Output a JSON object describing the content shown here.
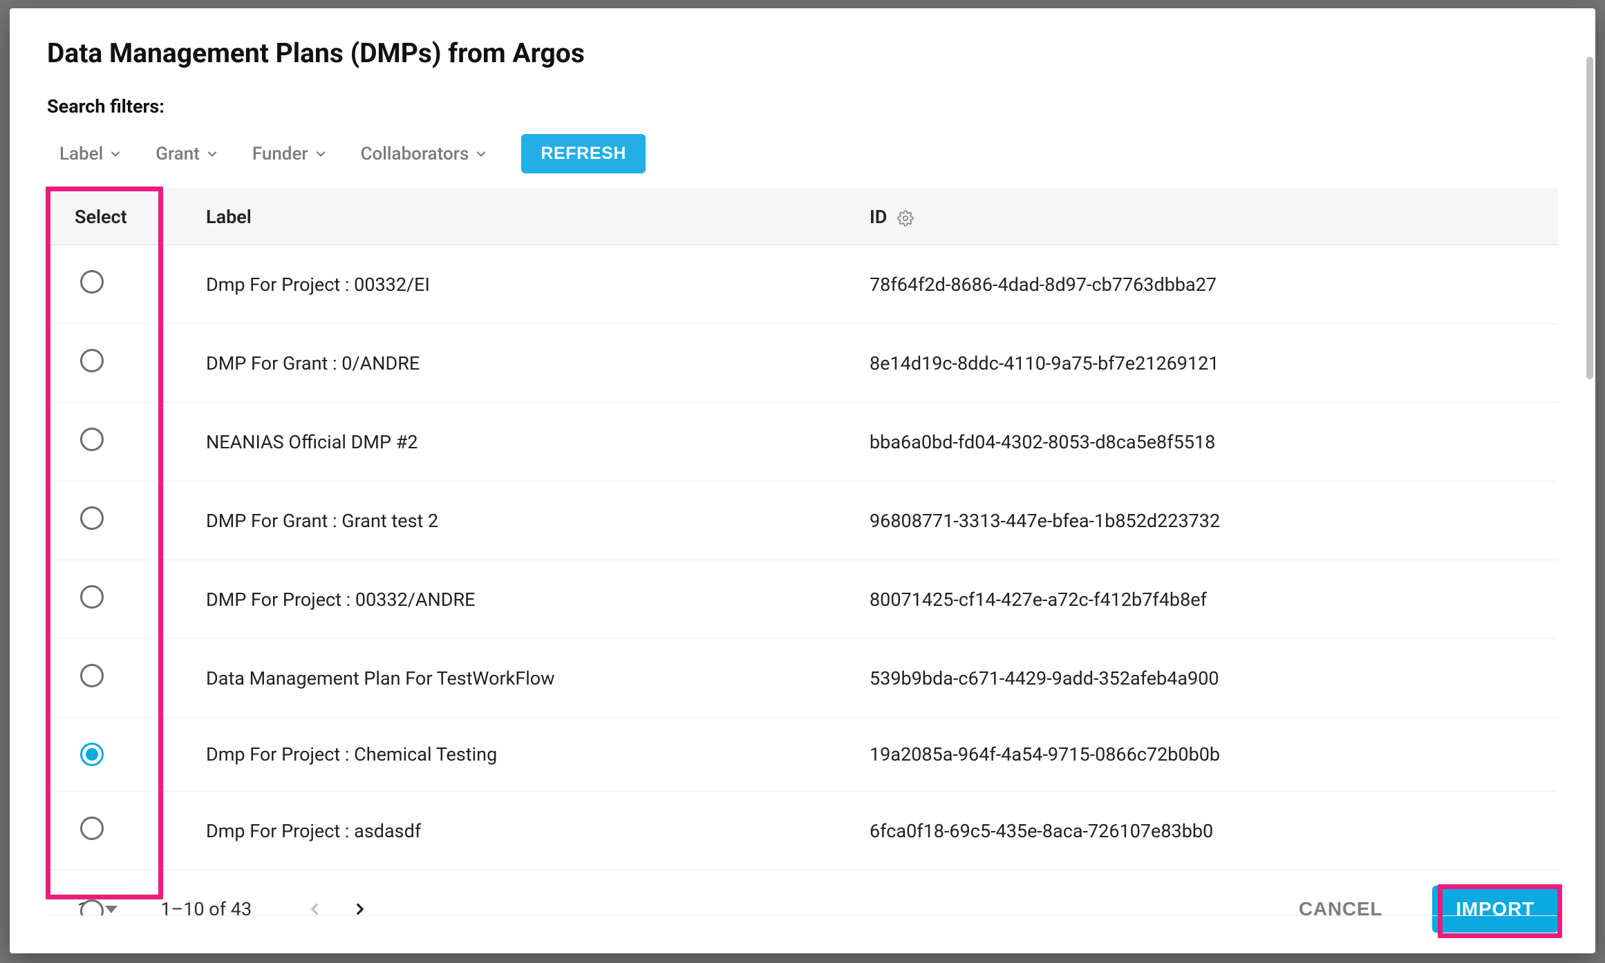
{
  "dialog": {
    "title": "Data Management Plans (DMPs) from Argos",
    "search_filters_label": "Search filters:",
    "refresh_label": "REFRESH",
    "filters": [
      {
        "label": "Label"
      },
      {
        "label": "Grant"
      },
      {
        "label": "Funder"
      },
      {
        "label": "Collaborators"
      }
    ],
    "columns": {
      "select": "Select",
      "label": "Label",
      "id": "ID"
    },
    "rows": [
      {
        "selected": false,
        "label": "Dmp For Project : 00332/EI",
        "id": "78f64f2d-8686-4dad-8d97-cb7763dbba27"
      },
      {
        "selected": false,
        "label": "DMP For Grant : 0/ANDRE",
        "id": "8e14d19c-8ddc-4110-9a75-bf7e21269121"
      },
      {
        "selected": false,
        "label": "NEANIAS Official DMP #2",
        "id": "bba6a0bd-fd04-4302-8053-d8ca5e8f5518"
      },
      {
        "selected": false,
        "label": "DMP For Grant : Grant test 2",
        "id": "96808771-3313-447e-bfea-1b852d223732"
      },
      {
        "selected": false,
        "label": "DMP For Project : 00332/ANDRE",
        "id": "80071425-cf14-427e-a72c-f412b7f4b8ef"
      },
      {
        "selected": false,
        "label": "Data Management Plan For TestWorkFlow",
        "id": "539b9bda-c671-4429-9add-352afeb4a900"
      },
      {
        "selected": true,
        "label": "Dmp For Project : Chemical Testing",
        "id": "19a2085a-964f-4a54-9715-0866c72b0b0b"
      },
      {
        "selected": false,
        "label": "Dmp For Project : asdasdf",
        "id": "6fca0f18-69c5-435e-8aca-726107e83bb0"
      }
    ],
    "pagination": {
      "page_size": "10",
      "range": "1–10 of 43",
      "prev_enabled": false,
      "next_enabled": true
    },
    "actions": {
      "cancel": "CANCEL",
      "import": "IMPORT"
    }
  },
  "colors": {
    "accent": "#0aa9e2",
    "annotation": "#ea1e7a"
  }
}
